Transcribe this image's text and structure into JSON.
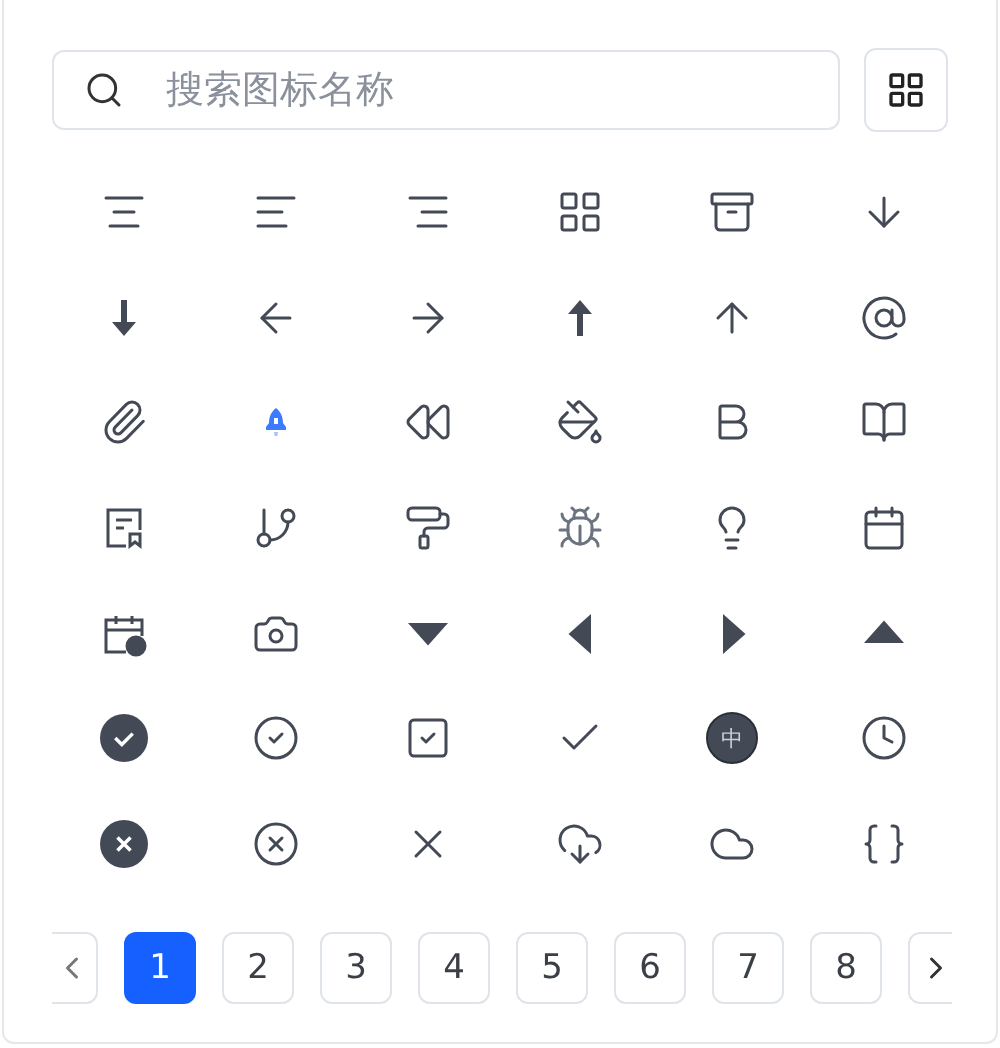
{
  "search": {
    "placeholder": "搜索图标名称"
  },
  "icons": [
    {
      "kind": "align-center"
    },
    {
      "kind": "align-left"
    },
    {
      "kind": "align-right"
    },
    {
      "kind": "grid"
    },
    {
      "kind": "archive"
    },
    {
      "kind": "arrow-down"
    },
    {
      "kind": "arrow-down-bold"
    },
    {
      "kind": "arrow-left"
    },
    {
      "kind": "arrow-right"
    },
    {
      "kind": "arrow-up-bold"
    },
    {
      "kind": "arrow-up"
    },
    {
      "kind": "at-sign"
    },
    {
      "kind": "paperclip"
    },
    {
      "kind": "rocket"
    },
    {
      "kind": "rewind"
    },
    {
      "kind": "paint-bucket"
    },
    {
      "kind": "bold"
    },
    {
      "kind": "book"
    },
    {
      "kind": "document-bookmark"
    },
    {
      "kind": "branch"
    },
    {
      "kind": "paint-roller"
    },
    {
      "kind": "bug"
    },
    {
      "kind": "lightbulb"
    },
    {
      "kind": "calendar"
    },
    {
      "kind": "calendar-clock"
    },
    {
      "kind": "camera"
    },
    {
      "kind": "triangle-down"
    },
    {
      "kind": "triangle-left"
    },
    {
      "kind": "triangle-right"
    },
    {
      "kind": "triangle-up"
    },
    {
      "kind": "check-circle-filled"
    },
    {
      "kind": "check-circle"
    },
    {
      "kind": "check-square"
    },
    {
      "kind": "check"
    },
    {
      "kind": "char-circle",
      "text": "中"
    },
    {
      "kind": "clock"
    },
    {
      "kind": "x-circle-filled"
    },
    {
      "kind": "x-circle"
    },
    {
      "kind": "x"
    },
    {
      "kind": "cloud-download"
    },
    {
      "kind": "cloud"
    },
    {
      "kind": "braces"
    }
  ],
  "pagination": {
    "pages": [
      {
        "label": "1",
        "selected": true
      },
      {
        "label": "2",
        "selected": false
      },
      {
        "label": "3",
        "selected": false
      },
      {
        "label": "4",
        "selected": false
      },
      {
        "label": "5",
        "selected": false
      },
      {
        "label": "6",
        "selected": false
      },
      {
        "label": "7",
        "selected": false
      },
      {
        "label": "8",
        "selected": false
      }
    ]
  }
}
